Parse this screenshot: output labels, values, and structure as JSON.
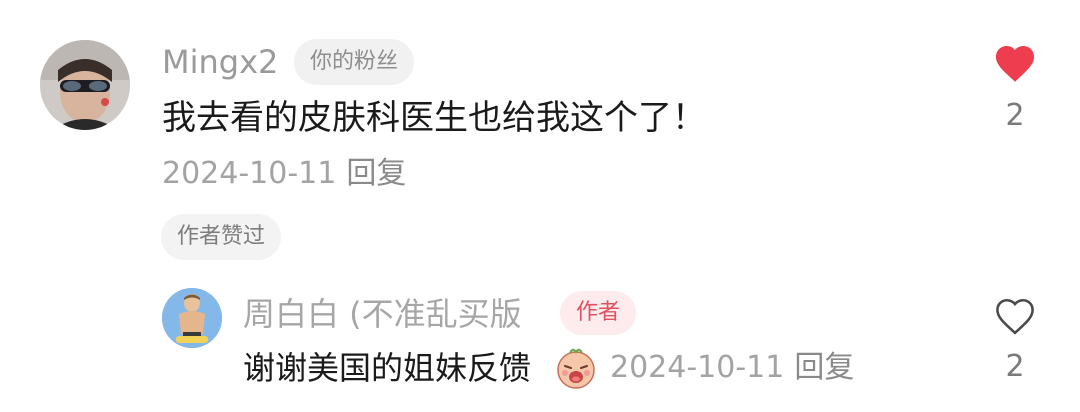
{
  "comment": {
    "username": "Mingx2",
    "fan_badge": "你的粉丝",
    "text": "我去看的皮肤科医生也给我这个了！",
    "date": "2024-10-11",
    "reply_label": "回复",
    "author_liked_badge": "作者赞过",
    "like_count": "2",
    "liked": true,
    "like_icon": "heart-filled-icon",
    "like_color": "#ee3d4f",
    "avatar_icon": "user-avatar"
  },
  "reply": {
    "username": "周白白 (不准乱买版",
    "author_badge": "作者",
    "text": "谢谢美国的姐妹反馈",
    "emoji_icon": "crying-face-emoji",
    "date": "2024-10-11",
    "reply_label": "回复",
    "like_count": "2",
    "liked": false,
    "like_icon": "heart-outline-icon",
    "author_badge_color": "#e0525f",
    "avatar_icon": "user-avatar"
  }
}
